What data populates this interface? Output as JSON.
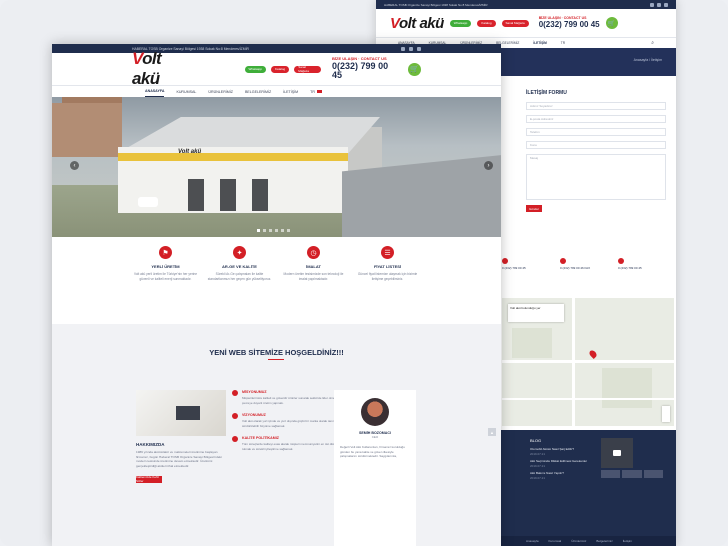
{
  "back": {
    "topbar": "HABERAL TOSB Organize Sanayi Bölgesi 1938 Sokak No:8 Menderes/İZMİR",
    "logo": {
      "mark": "V",
      "rest": "olt akü"
    },
    "buttons": [
      "Whatsapp",
      "Katalog",
      "Sanal Mağaza"
    ],
    "call": {
      "title": "BİZE ULAŞIN · CONTACT US",
      "phone": "0(232) 799 00 45"
    },
    "cart": "🛒",
    "nav": [
      "ANASAYFA",
      "KURUMSAL",
      "ÜRÜNLERİMİZ",
      "BELGELERİMİZ",
      "İLETİŞİM",
      "TR"
    ],
    "crumb": "Anasayfa / İletişim",
    "form": {
      "title": "İLETİŞİM FORMU",
      "fields": [
        "Adınız Soyadınız",
        "E-posta Adresiniz",
        "Telefon",
        "Konu"
      ],
      "message": "Mesaj",
      "submit": "Gönder"
    },
    "contacts": [
      "0 (232) 799 00 45",
      "0 (232) 799 00 46 FAX",
      "0 (232) 799 00 45"
    ],
    "map_card": "Volt akü bulunduğu yer",
    "footer": {
      "news_title": "BLOG",
      "news": [
        {
          "title": "Otomobil Aküsü Nasıl Şarj Edilir?",
          "date": "2019.07.21"
        },
        {
          "title": "Akü Seçiminde Dikkat Edilmesi Gerekenler",
          "date": "2019.07.21"
        },
        {
          "title": "Akü Bakımı Nasıl Yapılır?",
          "date": "2019.07.21"
        }
      ],
      "bottom": [
        "Anasayfa",
        "Kurumsal",
        "Ürünlerimiz",
        "Belgelerimiz",
        "İletişim"
      ]
    }
  },
  "front": {
    "topbar": "HABERAL TOSB Organize Sanayi Bölgesi 1938 Sokak No:8 Menderes/İZMİR",
    "logo": {
      "mark": "V",
      "rest": "olt akü"
    },
    "buttons": [
      "Whatsapp",
      "Katalog",
      "Sanal Mağaza"
    ],
    "call": {
      "title": "BİZE ULAŞIN · CONTACT US",
      "phone": "0(232) 799 00 45"
    },
    "cart": "🛒",
    "nav": [
      "ANASAYFA",
      "KURUMSAL",
      "ÜRÜNLERİMİZ",
      "BELGELERİMİZ",
      "İLETİŞİM",
      "TR"
    ],
    "hero": {
      "sign": "Volt akü",
      "prev": "‹",
      "next": "›",
      "slides": 6,
      "active_slide": 1
    },
    "features": [
      {
        "icon": "⚑",
        "title": "YERLİ ÜRETİM",
        "desc": "Volt akü yerli üretim ile Türkiye'nin her yerine güvenli ve kaliteli enerji sunmaktadır."
      },
      {
        "icon": "✦",
        "title": "AR-GE VE KALİTE",
        "desc": "Sürekli Ar-Ge çalışmaları ile kalite standartlarımızı her geçen gün yükseltiyoruz."
      },
      {
        "icon": "◷",
        "title": "İMALAT",
        "desc": "Modern üretim tesisimizde son teknoloji ile imalat yapılmaktadır."
      },
      {
        "icon": "☰",
        "title": "FİYAT LİSTESİ",
        "desc": "Güncel fiyat listemize ulaşmak için bizimle iletişime geçebilirsiniz."
      }
    ],
    "welcome": {
      "title": "YENİ WEB SİTEMİZE HOŞGELDİNİZ!!!",
      "about": {
        "title": "HAKKIMIZDA",
        "desc": "1989 yılında akümülatör ve malzemeleri üretimine başlayan firmamız, bugün Haberal TOSB Organize Sanayi Bölgesi'ndeki modern tesisinde üretimine devam etmektedir. Üretimini gerçekleştirdiği aküleri ithal etmektedir.",
        "button": "Kalitemizde Kefiz Sizler"
      },
      "items": [
        {
          "title": "MİSYONUMUZ",
          "desc": "Müşterilerimize kaliteli ve güvenilir ürünler sunarak sektörde lider olmak ve çevreye duyarlı üretim yapmak."
        },
        {
          "title": "VİZYONUMUZ",
          "desc": "Volt akü olarak yurt içinde ve yurt dışında güçlü bir marka olarak tanınmak ve sürdürülebilir büyüme sağlamak."
        },
        {
          "title": "KALİTE POLİTİKAMIZ",
          "desc": "Tüm süreçlerde kaliteyi esas alarak müşteri memnuniyetini en üst düzeyde tutmak ve sürekli iyileştirme sağlamak."
        }
      ],
      "person": {
        "name": "SEMİH BOZOMACI",
        "role": "CEO",
        "desc": "Değerli Volt Akü Kullanıcıları, firmamız kurulduğu günden bu yana kalite ve güven ilkesiyle çalışmalarını sürdürmektedir. Saygılarımla,"
      }
    }
  }
}
